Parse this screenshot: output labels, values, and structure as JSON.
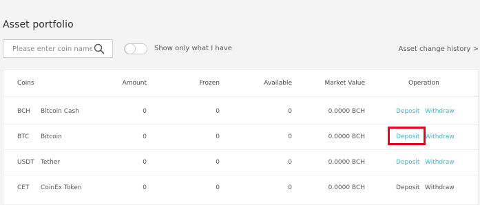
{
  "page": {
    "title": "Asset portfolio"
  },
  "search": {
    "placeholder": "Please enter coin name",
    "value": "",
    "icon": "search-icon"
  },
  "filter": {
    "label": "Show only what I have",
    "checked": false
  },
  "history_link": "Asset change history >",
  "table": {
    "headers": {
      "coins": "Coins",
      "amount": "Amount",
      "frozen": "Frozen",
      "available": "Available",
      "market_value": "Market Value",
      "operation": "Operation"
    },
    "rows": [
      {
        "symbol": "BCH",
        "name": "Bitcoin Cash",
        "amount": "0",
        "frozen": "0",
        "available": "0",
        "market_value": "0.0000 BCH",
        "deposit": "Deposit",
        "withdraw": "Withdraw",
        "enabled": true
      },
      {
        "symbol": "BTC",
        "name": "Bitcoin",
        "amount": "0",
        "frozen": "0",
        "available": "0",
        "market_value": "0.0000 BCH",
        "deposit": "Deposit",
        "withdraw": "Withdraw",
        "enabled": true
      },
      {
        "symbol": "USDT",
        "name": "Tether",
        "amount": "0",
        "frozen": "0",
        "available": "0",
        "market_value": "0.0000 BCH",
        "deposit": "Deposit",
        "withdraw": "Withdraw",
        "enabled": true
      },
      {
        "symbol": "CET",
        "name": "CoinEx Token",
        "amount": "0",
        "frozen": "0",
        "available": "0",
        "market_value": "0.0000 BCH",
        "deposit": "Deposit",
        "withdraw": "Withdraw",
        "enabled": false
      }
    ]
  },
  "colors": {
    "link": "#4fb0c6",
    "highlight": "#e8001c",
    "background": "#f4f4f4"
  }
}
